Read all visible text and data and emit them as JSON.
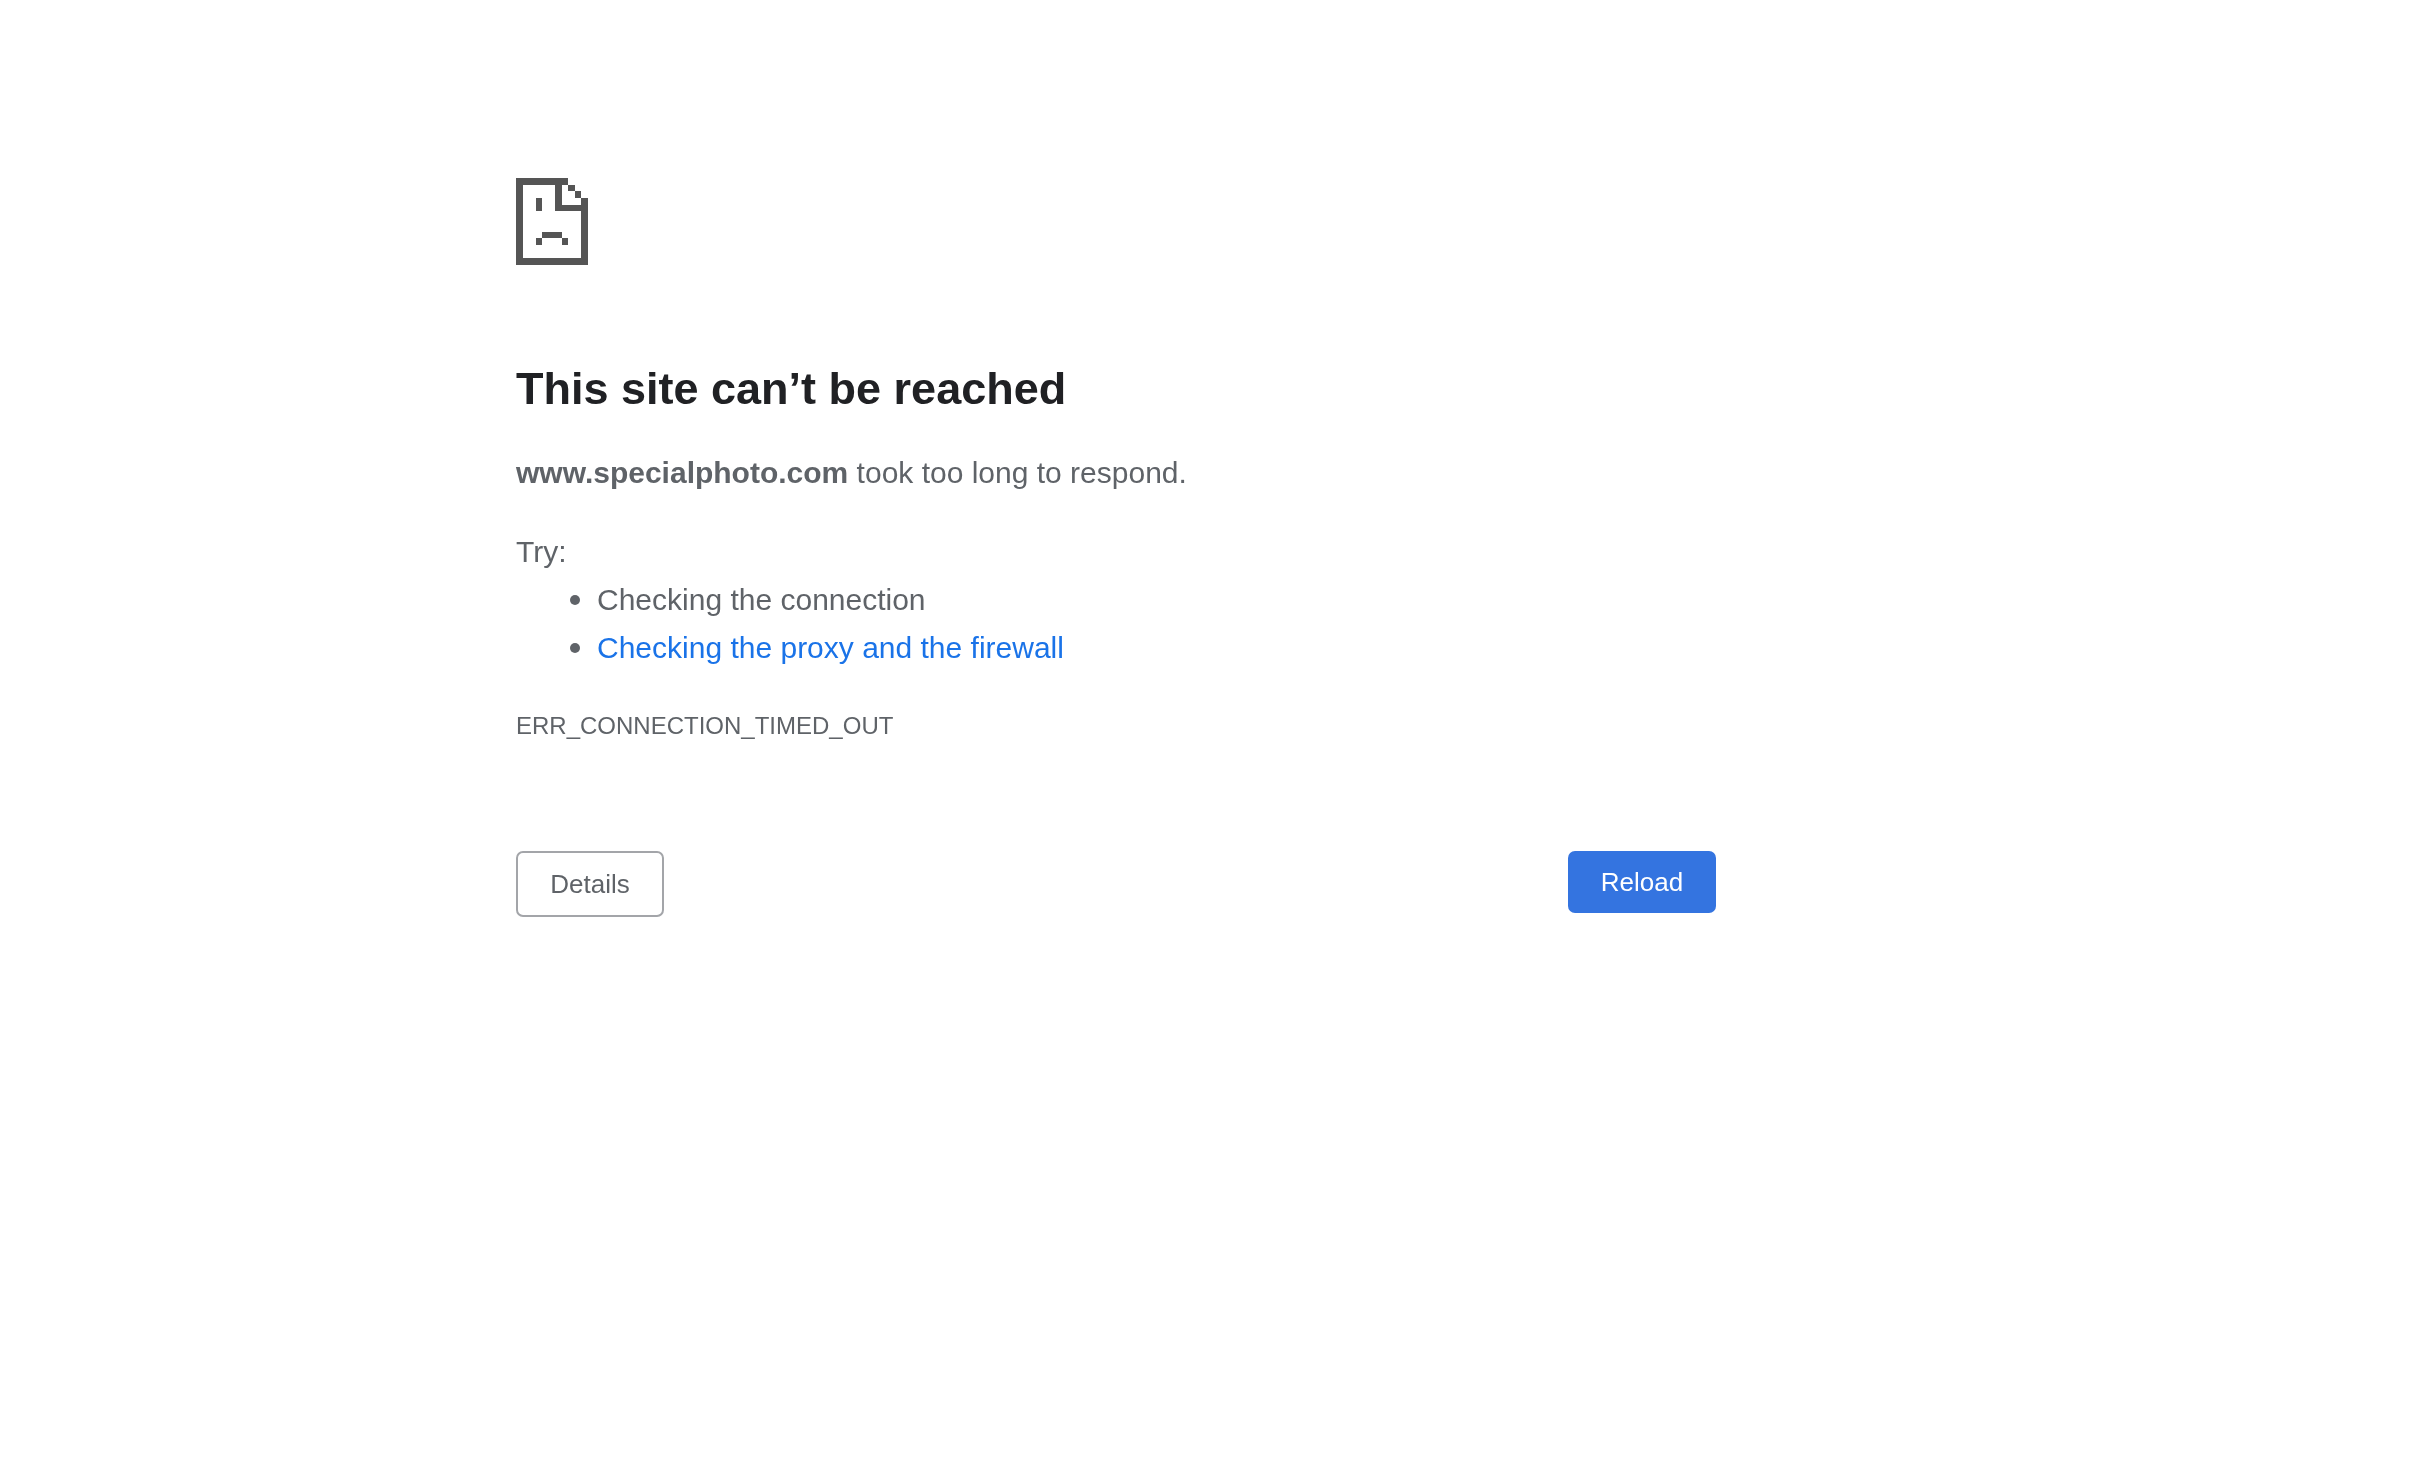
{
  "error_page": {
    "heading": "This site can’t be reached",
    "message": "**www.specialphoto.com** took too long to respond.",
    "suggestions_label": "Try:",
    "suggestions": [
      {
        "kind": "text",
        "text": "Checking the connection"
      },
      {
        "kind": "link",
        "text": "Checking the proxy and the firewall"
      }
    ],
    "error_code": "ERR_CONNECTION_TIMED_OUT",
    "buttons": [
      {
        "kind": "secondary",
        "label": "Details"
      },
      {
        "kind": "primary",
        "label": "Reload"
      }
    ]
  }
}
